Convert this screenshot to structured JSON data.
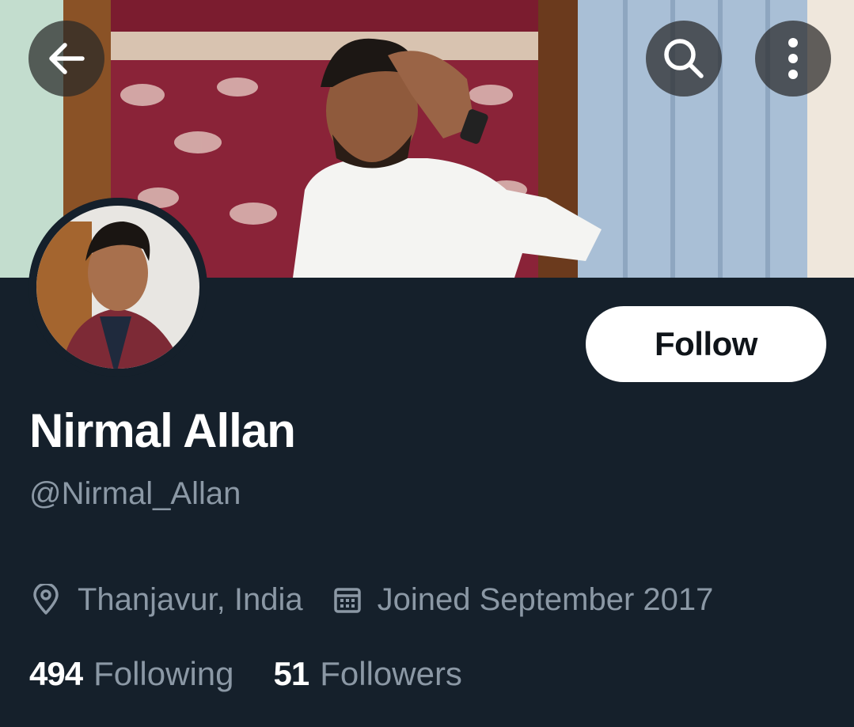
{
  "header": {
    "back_icon": "arrow-left-icon",
    "search_icon": "search-icon",
    "more_icon": "more-vertical-icon"
  },
  "profile": {
    "follow_label": "Follow",
    "display_name": "Nirmal Allan",
    "handle": "@Nirmal_Allan",
    "location": "Thanjavur, India",
    "joined": "Joined September 2017",
    "following_count": "494",
    "following_label": "Following",
    "followers_count": "51",
    "followers_label": "Followers"
  },
  "colors": {
    "background": "#15202b",
    "secondary_text": "#8b98a5",
    "primary_text": "#ffffff",
    "follow_button_bg": "#ffffff"
  }
}
